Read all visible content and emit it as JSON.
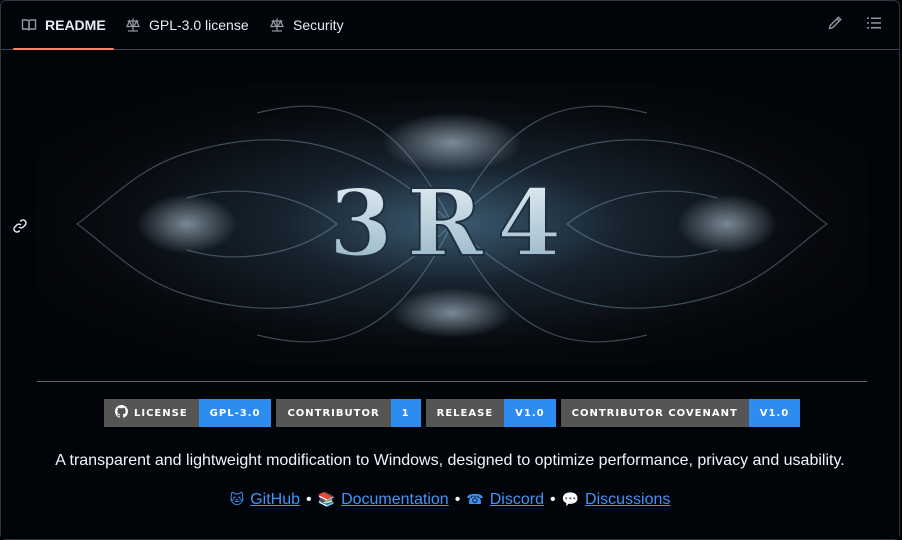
{
  "tabs": [
    {
      "label": "README",
      "icon": "book-icon",
      "active": true
    },
    {
      "label": "GPL-3.0 license",
      "icon": "law-icon",
      "active": false
    },
    {
      "label": "Security",
      "icon": "law-icon",
      "active": false
    }
  ],
  "toolbar": {
    "edit_icon": "pencil-icon",
    "outline_icon": "list-icon"
  },
  "banner": {
    "text": "3R4"
  },
  "badges": [
    {
      "label": "LICENSE",
      "value": "GPL-3.0",
      "icon": "github-icon"
    },
    {
      "label": "CONTRIBUTOR",
      "value": "1"
    },
    {
      "label": "RELEASE",
      "value": "V1.0"
    },
    {
      "label": "CONTRIBUTOR COVENANT",
      "value": "V1.0"
    }
  ],
  "description": "A transparent and lightweight modification to Windows, designed to optimize performance, privacy and usability.",
  "links": [
    {
      "emoji": "🐱",
      "label": "GitHub"
    },
    {
      "emoji": "📚",
      "label": "Documentation"
    },
    {
      "emoji": "☎",
      "label": "Discord"
    },
    {
      "emoji": "💬",
      "label": "Discussions"
    }
  ],
  "separator": "•",
  "colors": {
    "accent_underline": "#f78166",
    "badge_value": "#2d8cf0",
    "badge_label": "#555555",
    "link": "#4493f8"
  }
}
